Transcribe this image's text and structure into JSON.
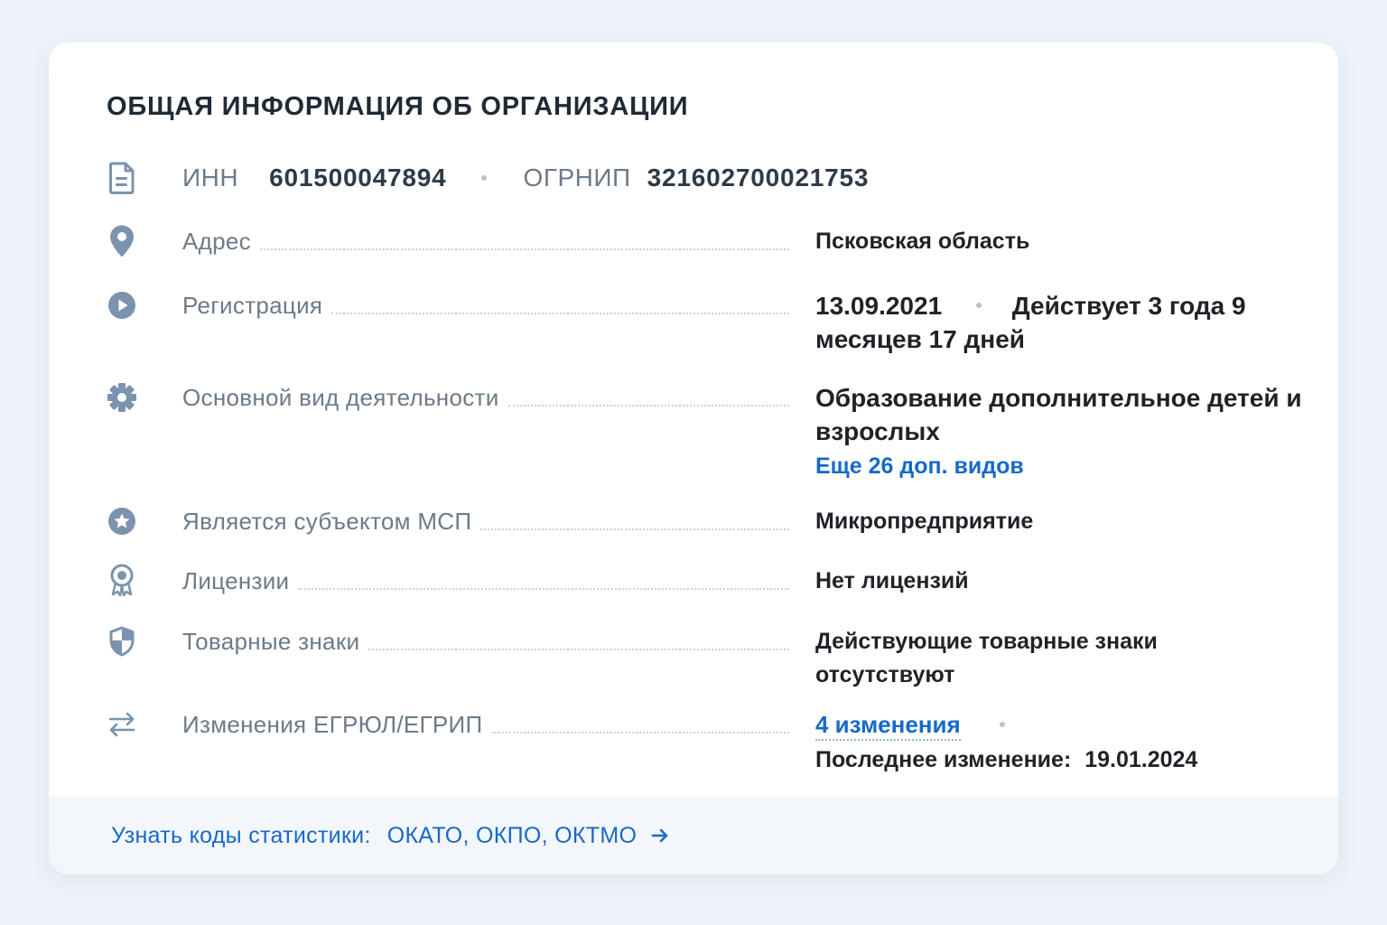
{
  "card": {
    "title": "ОБЩАЯ ИНФОРМАЦИЯ ОБ ОРГАНИЗАЦИИ",
    "ids": {
      "inn_label": "ИНН",
      "inn_value": "601500047894",
      "ogrnip_label": "ОГРНИП",
      "ogrnip_value": "321602700021753"
    },
    "rows": {
      "address": {
        "label": "Адрес",
        "value": "Псковская область",
        "icon": "location-pin-icon"
      },
      "registration": {
        "label": "Регистрация",
        "date": "13.09.2021",
        "status": "Действует 3 года 9 месяцев 17 дней",
        "icon": "play-circle-icon"
      },
      "activity": {
        "label": "Основной вид деятельности",
        "value": "Образование дополнительное детей и взрослых",
        "more_link": "Еще 26 доп. видов",
        "icon": "gear-icon"
      },
      "msp": {
        "label": "Является субъектом МСП",
        "value": "Микропредприятие",
        "icon": "star-circle-icon"
      },
      "licenses": {
        "label": "Лицензии",
        "value": "Нет лицензий",
        "icon": "award-icon"
      },
      "trademarks": {
        "label": "Товарные знаки",
        "value": "Действующие товарные знаки отсутствуют",
        "icon": "shield-icon"
      },
      "changes": {
        "label": "Изменения ЕГРЮЛ/ЕГРИП",
        "count_link": "4 изменения",
        "last_change_label": "Последнее изменение:",
        "last_change_date": "19.01.2024",
        "icon": "swap-arrows-icon"
      }
    },
    "footer": {
      "label": "Узнать коды статистики:",
      "codes": "ОКАТО, ОКПО, ОКТМО",
      "icon": "arrow-right-icon"
    },
    "colors": {
      "icon": "#7b93ad",
      "link": "#1769c8",
      "label": "#6c7a89",
      "background": "#eef3f9"
    }
  }
}
